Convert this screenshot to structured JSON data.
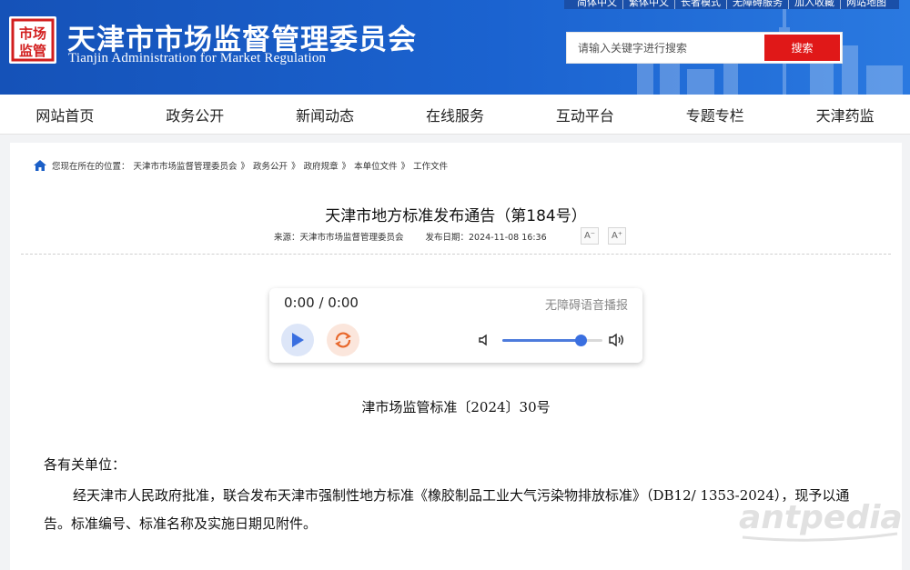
{
  "header": {
    "top_links": [
      "简体中文",
      "繁体中文",
      "长者模式",
      "无障碍服务",
      "加入收藏",
      "网站地图"
    ],
    "logo_text": "市场监管",
    "title": "天津市市场监督管理委员会",
    "subtitle": "Tianjin Administration for Market Regulation",
    "search_placeholder": "请输入关键字进行搜索",
    "search_button": "搜索"
  },
  "nav": {
    "items": [
      "网站首页",
      "政务公开",
      "新闻动态",
      "在线服务",
      "互动平台",
      "专题专栏",
      "天津药监"
    ]
  },
  "breadcrumb": {
    "prefix": "您现在所在的位置：",
    "items": [
      "天津市市场监督管理委员会",
      "政务公开",
      "政府规章",
      "本单位文件",
      "工作文件"
    ],
    "separator": "》"
  },
  "article": {
    "title": "天津市地方标准发布通告（第184号）",
    "source": "来源：天津市市场监督管理委员会",
    "date": "发布日期：2024-11-08 16:36",
    "font_smaller": "A⁻",
    "font_larger": "A⁺",
    "doc_number": "津市场监管标准〔2024〕30号",
    "salutation": "各有关单位：",
    "body": "经天津市人民政府批准，联合发布天津市强制性地方标准《橡胶制品工业大气污染物排放标准》（DB12/ 1353-2024），现予以通告。标准编号、标准名称及实施日期见附件。"
  },
  "player": {
    "time": "0:00 / 0:00",
    "label": "无障碍语音播报",
    "volume": 0.78
  },
  "watermark": "antpedia",
  "colors": {
    "header_blue": "#1b63d0",
    "search_red": "#e01818",
    "accent_blue": "#3a6fe0"
  }
}
